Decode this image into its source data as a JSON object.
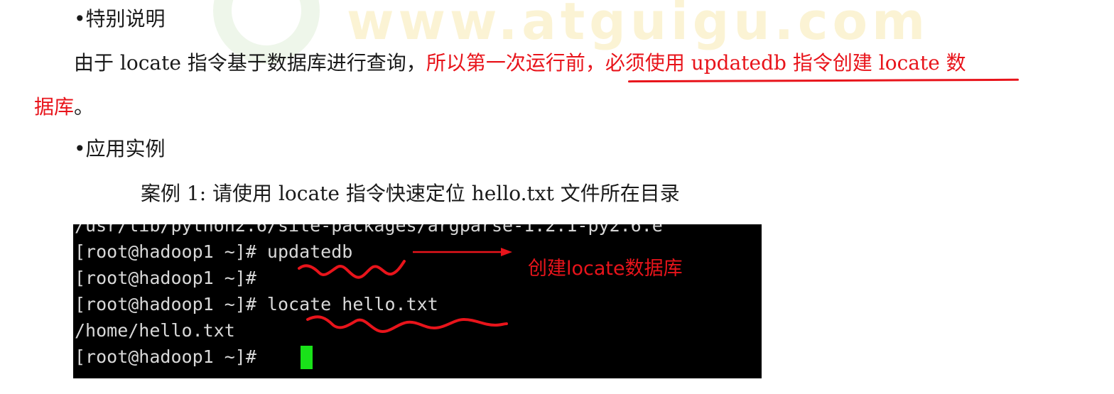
{
  "section_special": {
    "bullet": "•",
    "title": "特别说明"
  },
  "paragraph": {
    "text_normal": "由于 locate 指令基于数据库进行查询，",
    "text_red_line1": "所以第一次运行前，必须使用 updatedb 指令创建 locate 数",
    "text_red_line2": "据库",
    "text_end": "。"
  },
  "section_example": {
    "bullet": "•",
    "title": "应用实例"
  },
  "case": {
    "text": "案例 1:  请使用 locate  指令快速定位  hello.txt  文件所在目录"
  },
  "terminal": {
    "lines": [
      "/usr/lib/python2.6/site-packages/argparse-1.2.1-py2.6.e",
      "[root@hadoop1 ~]# updatedb",
      "[root@hadoop1 ~]#",
      "[root@hadoop1 ~]# locate hello.txt",
      "/home/hello.txt",
      "[root@hadoop1 ~]# "
    ],
    "annotation": "创建locate数据库"
  },
  "watermark": {
    "text": "www.atguigu.com"
  },
  "colors": {
    "red_text": "#e8141b",
    "terminal_bg": "#000000",
    "terminal_fg": "#d8d8d8",
    "cursor": "#19e219"
  }
}
